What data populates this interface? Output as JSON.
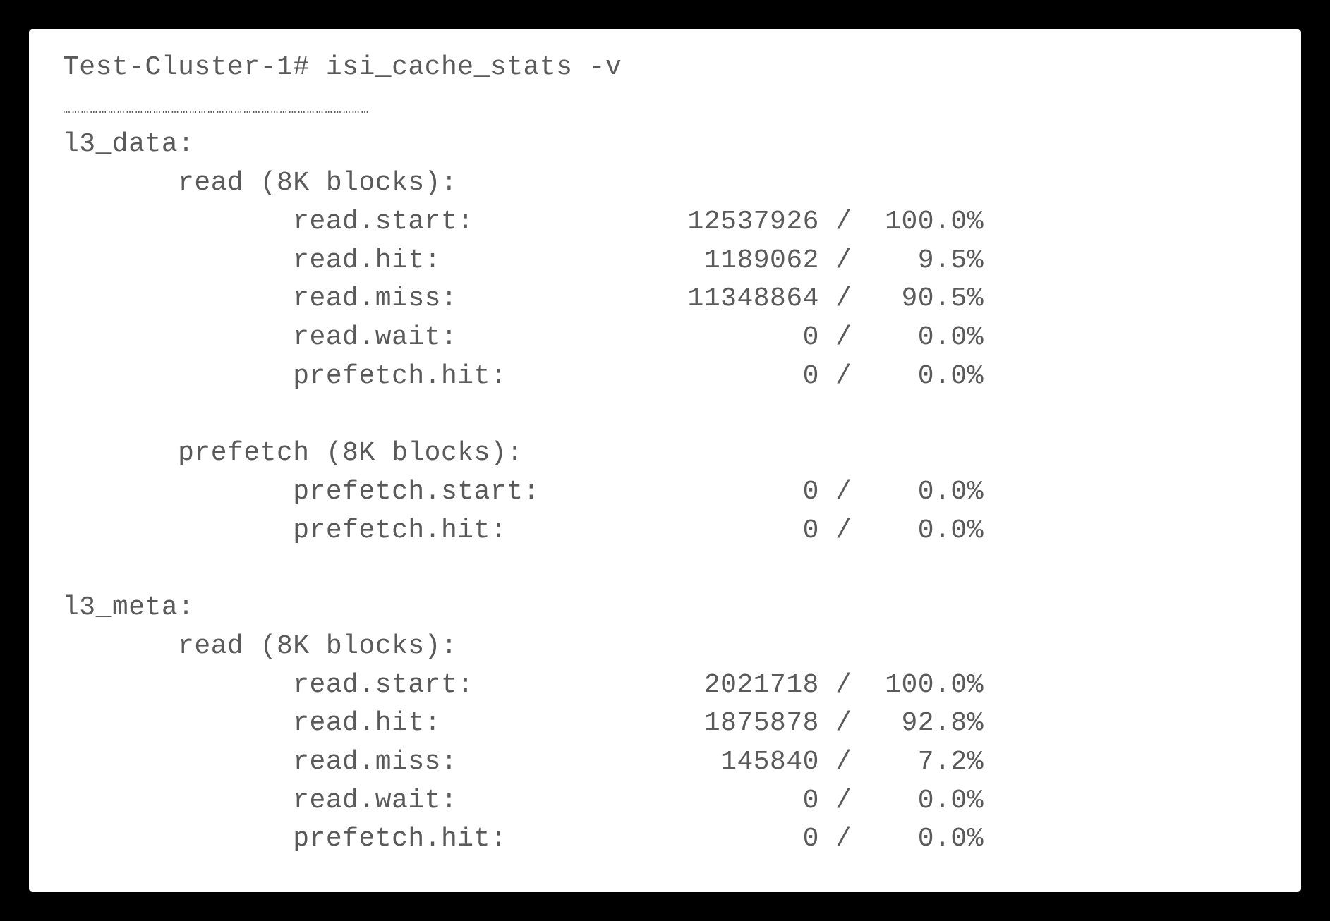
{
  "prompt": "Test-Cluster-1# isi_cache_stats -v",
  "ellipsis": "…………………………………………………………………………………………",
  "sections": {
    "l3_data": {
      "header": "l3_data:",
      "read": {
        "header": "read (8K blocks):",
        "rows": [
          {
            "label": "read.start:",
            "count": "12537926",
            "pct": "100.0%"
          },
          {
            "label": "read.hit:",
            "count": "1189062",
            "pct": "9.5%"
          },
          {
            "label": "read.miss:",
            "count": "11348864",
            "pct": "90.5%"
          },
          {
            "label": "read.wait:",
            "count": "0",
            "pct": "0.0%"
          },
          {
            "label": "prefetch.hit:",
            "count": "0",
            "pct": "0.0%"
          }
        ]
      },
      "prefetch": {
        "header": "prefetch (8K blocks):",
        "rows": [
          {
            "label": "prefetch.start:",
            "count": "0",
            "pct": "0.0%"
          },
          {
            "label": "prefetch.hit:",
            "count": "0",
            "pct": "0.0%"
          }
        ]
      }
    },
    "l3_meta": {
      "header": "l3_meta:",
      "read": {
        "header": "read (8K blocks):",
        "rows": [
          {
            "label": "read.start:",
            "count": "2021718",
            "pct": "100.0%"
          },
          {
            "label": "read.hit:",
            "count": "1875878",
            "pct": "92.8%"
          },
          {
            "label": "read.miss:",
            "count": "145840",
            "pct": "7.2%"
          },
          {
            "label": "read.wait:",
            "count": "0",
            "pct": "0.0%"
          },
          {
            "label": "prefetch.hit:",
            "count": "0",
            "pct": "0.0%"
          }
        ]
      }
    }
  },
  "layout": {
    "indent_subheader": 7,
    "indent_row_label": 14,
    "count_col_right_edge": 46,
    "pct_col_width": 7
  }
}
